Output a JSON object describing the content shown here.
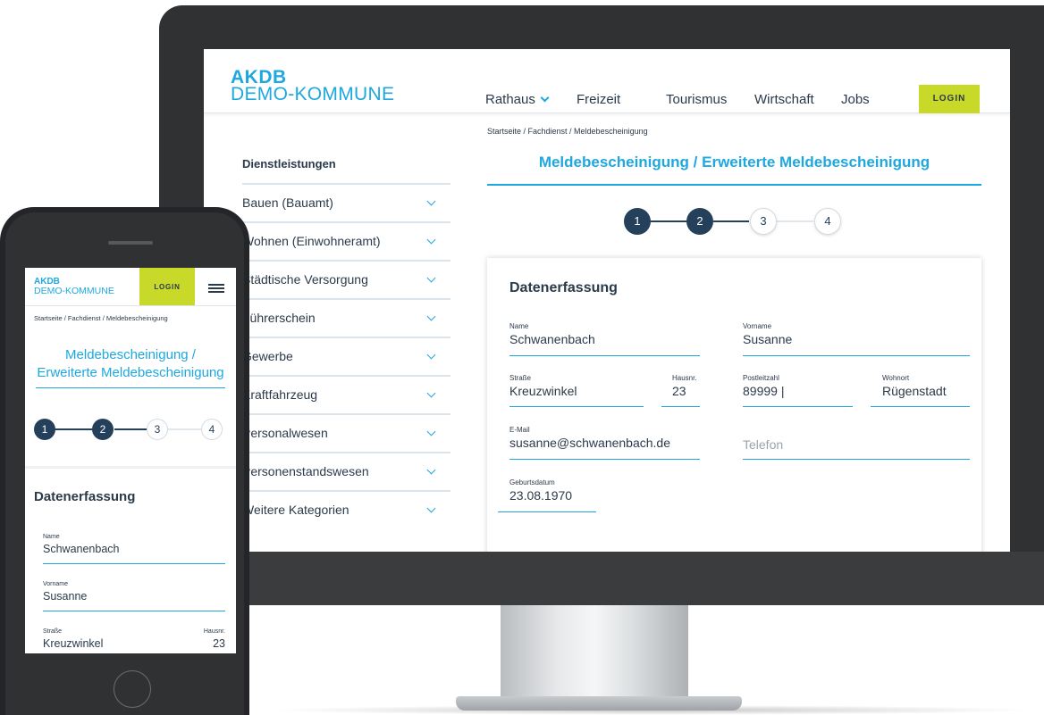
{
  "colors": {
    "accent": "#1ea8df",
    "login_bg": "#c9d92a",
    "step_done": "#24405a",
    "text": "#2b3a4a"
  },
  "desktop": {
    "logo": {
      "line1": "AKDB",
      "line2": "DEMO-KOMMUNE"
    },
    "nav": [
      {
        "label": "Rathaus",
        "icon": "chevron-down-icon"
      },
      {
        "label": "Freizeit"
      },
      {
        "label": "Tourismus"
      },
      {
        "label": "Wirtschaft"
      },
      {
        "label": "Jobs"
      }
    ],
    "login_label": "LOGIN",
    "breadcrumb": "Startseite / Fachdienst / Meldebescheinigung",
    "page_title": "Meldebescheinigung / Erweiterte Meldebescheinigung",
    "sidebar": {
      "heading": "Dienstleistungen",
      "items": [
        "Bauen (Bauamt)",
        "Wohnen (Einwohneramt)",
        "Städtische Versorgung",
        "Führerschein",
        "Gewerbe",
        "Kraftfahrzeug",
        "Personalwesen",
        "Personenstandswesen",
        "Weitere Kategorien"
      ]
    },
    "steps": [
      "1",
      "2",
      "3",
      "4"
    ],
    "current_step": 2,
    "form": {
      "title": "Datenerfassung",
      "name": {
        "label": "Name",
        "value": "Schwanenbach"
      },
      "vorname": {
        "label": "Vorname",
        "value": "Susanne"
      },
      "strasse": {
        "label": "Straße",
        "value": "Kreuzwinkel"
      },
      "hausnr": {
        "label": "Hausnr.",
        "value": "23"
      },
      "plz": {
        "label": "Postleitzahl",
        "value": "89999 |"
      },
      "wohnort": {
        "label": "Wohnort",
        "value": "Rügenstadt"
      },
      "email": {
        "label": "E-Mail",
        "value": "susanne@schwanenbach.de"
      },
      "telefon": {
        "placeholder": "Telefon"
      },
      "geburtsdatum": {
        "label": "Geburtsdatum",
        "value": "23.08.1970"
      }
    }
  },
  "mobile": {
    "logo": {
      "line1": "AKDB",
      "line2": "DEMO-KOMMUNE"
    },
    "login_label": "LOGIN",
    "breadcrumb": "Startseite / Fachdienst / Meldebescheinigung",
    "title_line1": "Meldebescheinigung /",
    "title_line2": "Erweiterte Meldebescheinigung",
    "steps": [
      "1",
      "2",
      "3",
      "4"
    ],
    "form": {
      "title": "Datenerfassung",
      "name": {
        "label": "Name",
        "value": "Schwanenbach"
      },
      "vorname": {
        "label": "Vorname",
        "value": "Susanne"
      },
      "strasse": {
        "label": "Straße",
        "value": "Kreuzwinkel"
      },
      "hausnr": {
        "label": "Hausnr.",
        "value": "23"
      }
    }
  }
}
